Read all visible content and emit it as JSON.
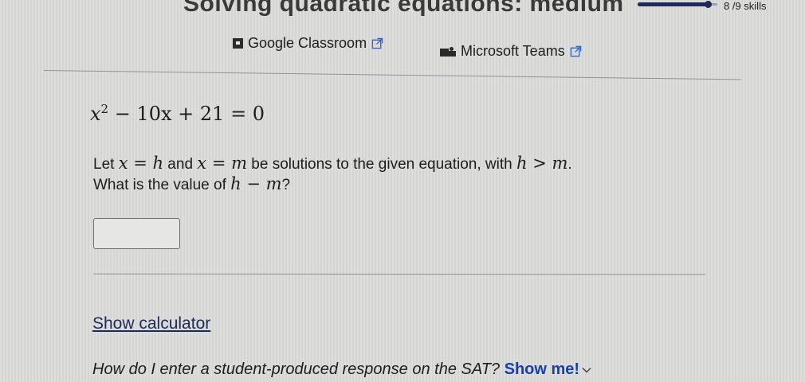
{
  "header": {
    "title": "Solving quadratic equations: medium",
    "progress_fraction": 0.89,
    "skills_count": "8 /9 skills"
  },
  "share": {
    "google_classroom": "Google Classroom",
    "microsoft_teams": "Microsoft Teams"
  },
  "problem": {
    "equation": {
      "a": "x",
      "exp": "2",
      "rest": " − 10x + 21 = 0"
    },
    "question_parts": [
      "Let ",
      "x = h",
      " and ",
      "x = m",
      " be solutions to the given equation, with ",
      "h > m",
      "."
    ],
    "question_line2_parts": [
      "What is the value of ",
      "h − m",
      "?"
    ]
  },
  "answer": {
    "value": ""
  },
  "links": {
    "show_calculator": "Show calculator",
    "help_text": "How do I enter a student-produced response on the SAT?",
    "show_me": "Show me!"
  },
  "colors": {
    "link": "#1e2b5c",
    "show_me": "#1a3fa8",
    "progress": "#1f2a5a"
  }
}
